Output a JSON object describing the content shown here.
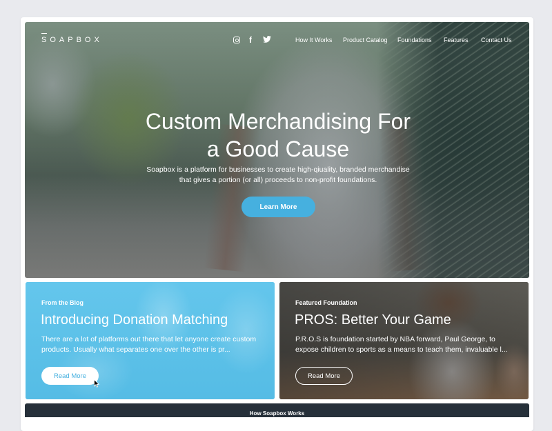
{
  "brand": {
    "logo": "SOAPBOX"
  },
  "social": [
    {
      "icon": "instagram-icon"
    },
    {
      "icon": "facebook-icon",
      "glyph": "f"
    },
    {
      "icon": "twitter-icon"
    }
  ],
  "nav": [
    "How It Works",
    "Product Catalog",
    "Foundations",
    "Features",
    "Contact Us"
  ],
  "hero": {
    "title_line1": "Custom Merchandising For",
    "title_line2": "a Good Cause",
    "subtitle_line1": "Soapbox is a platform for businesses to create high-qiuality, branded merchandise",
    "subtitle_line2": "that gives a portion (or all) proceeds to non-profit foundations.",
    "cta": "Learn More"
  },
  "cards": [
    {
      "kicker": "From the Blog",
      "title": "Introducing Donation Matching",
      "text": "There are a lot of platforms out there that let anyone create custom products. Usually what separates one over the other is pr...",
      "button": "Read More"
    },
    {
      "kicker": "Featured Foundation",
      "title": "PROS: Better Your Game",
      "text": "P.R.O.S is foundation started by NBA forward, Paul George, to expose children to sports as a means to teach them, invaluable l...",
      "button": "Read More"
    }
  ],
  "footer_band": {
    "text": "How Soapbox Works"
  },
  "colors": {
    "accent": "#46b0df",
    "blog_card": "#5ec3ea",
    "band": "#26303a"
  }
}
